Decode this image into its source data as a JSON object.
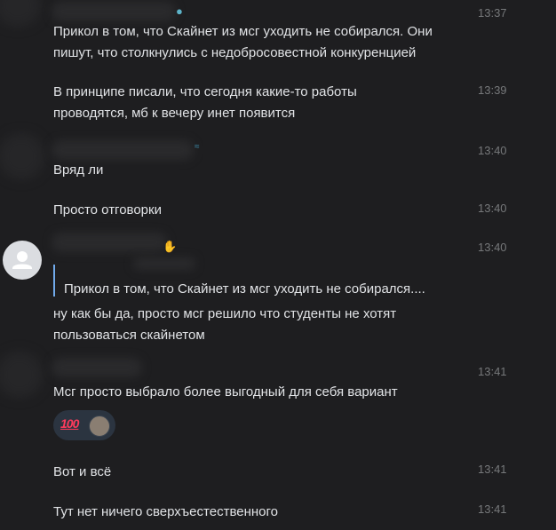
{
  "messages": [
    {
      "text": "Прикол в том, что Скайнет из мсг уходить не собирался. Они пишут, что столкнулись с недобросовестной конкуренцией",
      "time": "13:37"
    },
    {
      "text": "В принципе писали, что сегодня какие-то работы проводятся, мб к вечеру инет появится",
      "time": "13:39"
    },
    {
      "text": "Вряд ли",
      "time": "13:40"
    },
    {
      "text": "Просто отговорки",
      "time": "13:40"
    },
    {
      "reply_quote": "Прикол в том, что Скайнет из мсг уходить не собирался....",
      "text": "ну как бы да, просто мсг решило что студенты не хотят пользоваться скайнетом",
      "time": "13:40"
    },
    {
      "text": "Мсг просто выбрало более выгодный для себя вариант",
      "time": "13:41"
    },
    {
      "text": "Вот и всё",
      "time": "13:41"
    },
    {
      "text": "Тут нет ничего сверхъестественного",
      "time": "13:41"
    }
  ],
  "reaction": {
    "emoji": "100",
    "icon": "hundred-points-icon"
  },
  "icons": {
    "avatar": "user-placeholder-icon",
    "sender_emoji_1": "globe-icon",
    "sender_emoji_2": "wave-hand-icon"
  }
}
